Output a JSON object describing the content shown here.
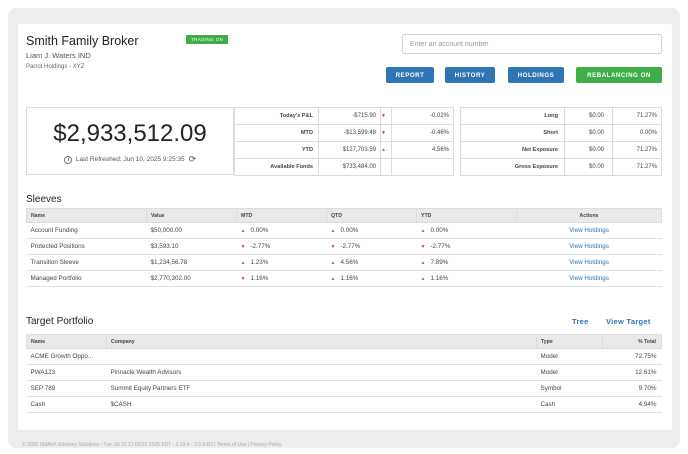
{
  "header": {
    "title": "Smith Family Broker",
    "badge": "TRADING ON",
    "client": "Liam J. Waters IND",
    "holdings": "Parrot Holdings - XYZ",
    "search_placeholder": "Enter an account number"
  },
  "buttons": {
    "report": "REPORT",
    "history": "HISTORY",
    "holdings": "HOLDINGS",
    "rebalancing": "REBALANCING ON"
  },
  "summary": {
    "value": "$2,933,512.09",
    "refreshed": "Last Refreshed: Jun 10, 2025 9:25:35"
  },
  "pnl": [
    {
      "label": "Today's P&L",
      "value": "-$715.90",
      "dir": "down",
      "pct": "-0.02%"
    },
    {
      "label": "MTD",
      "value": "-$13,599.48",
      "dir": "down",
      "pct": "-0.46%"
    },
    {
      "label": "YTD",
      "value": "$127,703.59",
      "dir": "up",
      "pct": "4.56%"
    },
    {
      "label": "Available Funds",
      "value": "$733,484.00",
      "dir": "",
      "pct": ""
    }
  ],
  "exposure": [
    {
      "label": "Long",
      "value": "$0.00",
      "pct": "71.27%"
    },
    {
      "label": "Short",
      "value": "$0.00",
      "pct": "0.00%"
    },
    {
      "label": "Net Exposure",
      "value": "$0.00",
      "pct": "71.27%"
    },
    {
      "label": "Gross Exposure",
      "value": "$0.00",
      "pct": "71.27%"
    }
  ],
  "sleeves": {
    "title": "Sleeves",
    "columns": [
      "Name",
      "Value",
      "MTD",
      "QTD",
      "YTD",
      "Actions"
    ],
    "rows": [
      {
        "name": "Account Funding",
        "value": "$50,000.00",
        "mtd": "0.00%",
        "mtd_dir": "up",
        "qtd": "0.00%",
        "qtd_dir": "up",
        "ytd": "0.00%",
        "ytd_dir": "up",
        "action": "View Holdings"
      },
      {
        "name": "Protected Positions",
        "value": "$3,593.10",
        "mtd": "-2.77%",
        "mtd_dir": "down",
        "qtd": "-2.77%",
        "qtd_dir": "down",
        "ytd": "-2.77%",
        "ytd_dir": "down",
        "action": "View Holdings"
      },
      {
        "name": "Transition Sleeve",
        "value": "$1,234,56.78",
        "mtd": "1.23%",
        "mtd_dir": "up",
        "qtd": "4.56%",
        "qtd_dir": "up",
        "ytd": "7.89%",
        "ytd_dir": "up",
        "action": "View Holdings"
      },
      {
        "name": "Managed Portfolio",
        "value": "$2,770,302.00",
        "mtd": "1.16%",
        "mtd_dir": "down",
        "qtd": "1.16%",
        "qtd_dir": "up",
        "ytd": "1.16%",
        "ytd_dir": "up",
        "action": "View Holdings"
      }
    ]
  },
  "target": {
    "title": "Target Portfolio",
    "tree_link": "Tree",
    "view_target_link": "View Target",
    "columns": [
      "Name",
      "Company",
      "Type",
      "% Total"
    ],
    "rows": [
      {
        "name": "ACME Growth Oppo...",
        "company": "",
        "type": "Model",
        "total": "72.75%"
      },
      {
        "name": "PWA123",
        "company": "Pinnacle Wealth Advisors",
        "type": "Model",
        "total": "12.61%"
      },
      {
        "name": "SEP 789",
        "company": "Summit Equity Partners ETF",
        "type": "Symbol",
        "total": "9.70%"
      },
      {
        "name": "Cash",
        "company": "$CASH",
        "type": "Cash",
        "total": "4.94%"
      }
    ]
  },
  "footer": "© 2025 SMArtX Advisory Solutions - Tue Jul 22 17:03:51 2025 EDT - 3.13.4 - 3.5.9.R2 | Terms of Use | Privacy Policy",
  "colors": {
    "primary": "#2f74b5",
    "success": "#3fae49",
    "danger": "#d63b3b"
  }
}
